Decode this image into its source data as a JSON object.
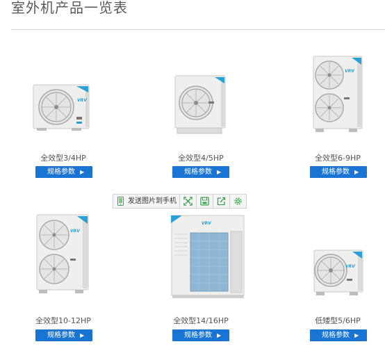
{
  "page": {
    "title": "室外机产品一览表"
  },
  "products": [
    {
      "label": "全效型3/4HP",
      "button": "规格参数"
    },
    {
      "label": "全效型4/5HP",
      "button": "规格参数"
    },
    {
      "label": "全效型6-9HP",
      "button": "规格参数"
    },
    {
      "label": "全效型10-12HP",
      "button": "规格参数"
    },
    {
      "label": "全效型14/16HP",
      "button": "规格参数"
    },
    {
      "label": "低矮型5/6HP",
      "button": "规格参数"
    }
  ],
  "toolbar": {
    "send_label": "发送图片到手机",
    "icons": [
      "phone-icon",
      "fullscreen-icon",
      "save-icon",
      "share-icon",
      "settings-icon"
    ]
  },
  "unit_logo_text": "VRV",
  "colors": {
    "accent": "#1a74d4",
    "icon_green": "#3aa54a",
    "logo_blue": "#2aa0d8"
  }
}
